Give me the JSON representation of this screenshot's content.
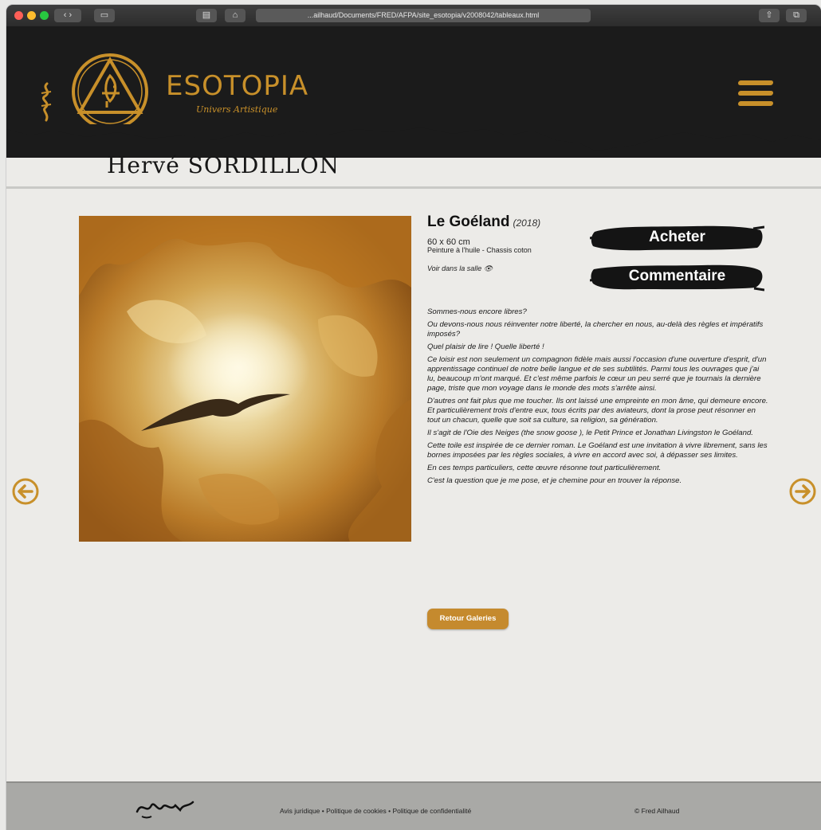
{
  "browser": {
    "url": "...ailhaud/Documents/FRED/AFPA/site_esotopia/v2008042/tableaux.html"
  },
  "header": {
    "brand": "ESOTOPIA",
    "tagline": "Univers Artistique"
  },
  "artist_name": "Hervé SORDILLON",
  "artwork": {
    "title": "Le Goéland",
    "year": "(2018)",
    "dimensions": "60 x 60 cm",
    "medium": "Peinture à l'huile - Chassis coton",
    "view_in_room": "Voir dans la salle 👁"
  },
  "buttons": {
    "buy": "Acheter",
    "comment": "Commentaire",
    "back": "Retour Galeries"
  },
  "description": [
    "Sommes-nous encore libres?",
    "Ou devons-nous nous réinventer notre liberté, la chercher en nous, au-delà des règles et impératifs imposés?",
    "Quel plaisir de lire ! Quelle liberté !",
    "Ce loisir est non seulement un compagnon fidèle mais aussi l'occasion d'une ouverture d'esprit, d'un apprentissage continuel de notre belle langue et de ses subtilités. Parmi tous les ouvrages que j'ai lu, beaucoup m'ont marqué. Et c'est même parfois le cœur un peu serré que je tournais la dernière page, triste que mon voyage dans le monde des mots s'arrête ainsi.",
    "D'autres ont fait plus que me toucher. Ils ont laissé une empreinte en mon âme, qui demeure encore. Et particulièrement trois d'entre eux, tous écrits par des aviateurs, dont la prose peut résonner en tout un chacun, quelle que soit sa culture, sa religion, sa génération.",
    "Il s'agit de l'Oie des Neiges (the snow goose ), le Petit Prince et Jonathan Livingston le Goéland.",
    "Cette toile est inspirée de ce dernier roman. Le Goéland est une invitation à vivre librement, sans les bornes imposées par les règles sociales, à vivre en accord avec soi, à dépasser ses limites.",
    "En ces temps particuliers, cette œuvre résonne tout particulièrement.",
    "C'est la question que je me pose, et je chemine pour en trouver la réponse."
  ],
  "footer": {
    "links": [
      "Avis juridique",
      "Politique de cookies",
      "Politique de confidentialité"
    ],
    "separator": "•",
    "copyright": "© Fred Ailhaud"
  },
  "colors": {
    "gold": "#c8902a",
    "header_bg": "#1b1b1b",
    "page_bg": "#ecebe8",
    "footer_bg": "#a9a9a6"
  }
}
